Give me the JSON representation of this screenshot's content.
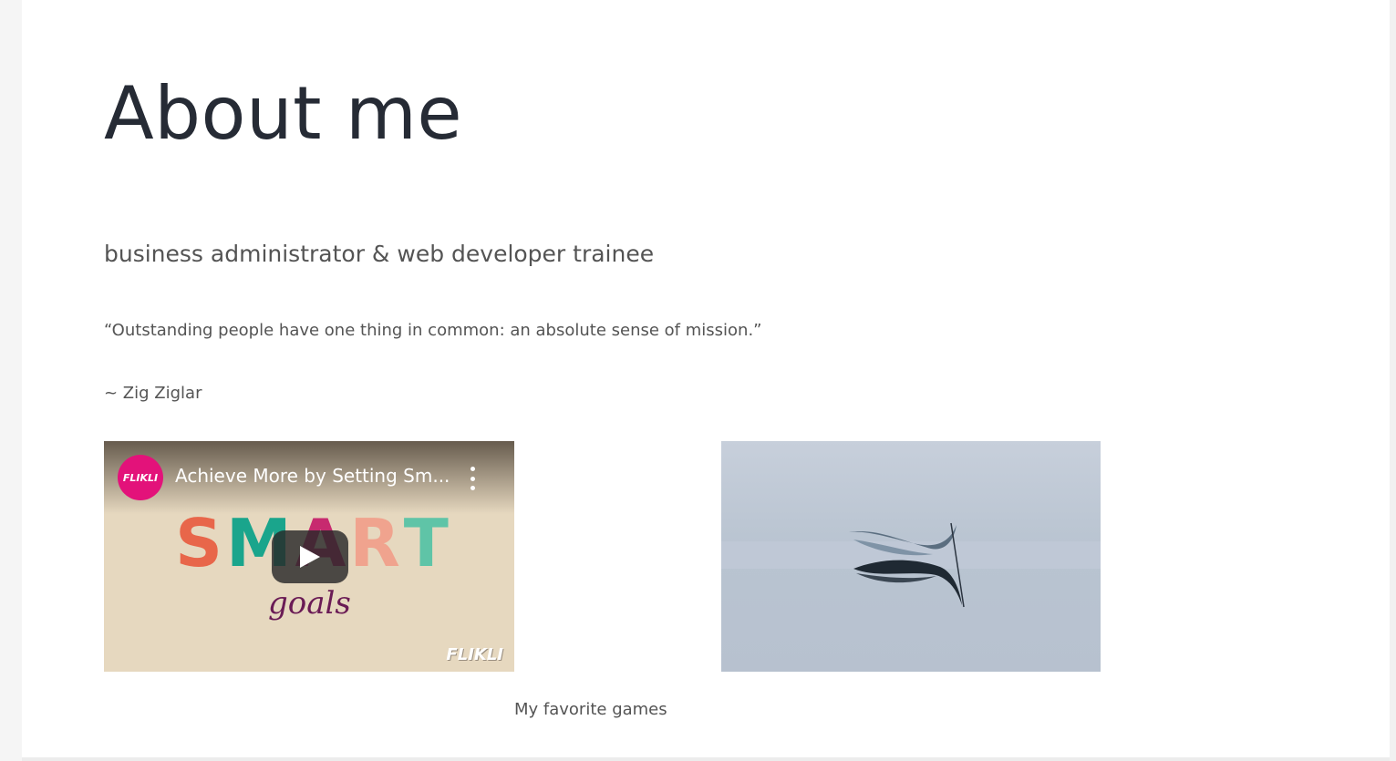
{
  "page": {
    "title": "About me",
    "subtitle": "business administrator & web developer trainee",
    "quote": "“Outstanding people have one thing in common: an absolute sense of mission.”",
    "author": "~ Zig Ziglar",
    "caption": "My favorite games"
  },
  "video": {
    "channel_logo": "FLIKLI",
    "title": "Achieve More by Setting Sm...",
    "thumbnail_word": "SMART",
    "thumbnail_sub": "goals",
    "watermark": "FLIKLI",
    "icons": {
      "play": "play-icon",
      "more": "more-vertical-icon"
    }
  },
  "image": {
    "subject": "feather-image"
  },
  "colors": {
    "heading": "#262b35",
    "text": "#545454",
    "logo_pink": "#e3127a"
  }
}
